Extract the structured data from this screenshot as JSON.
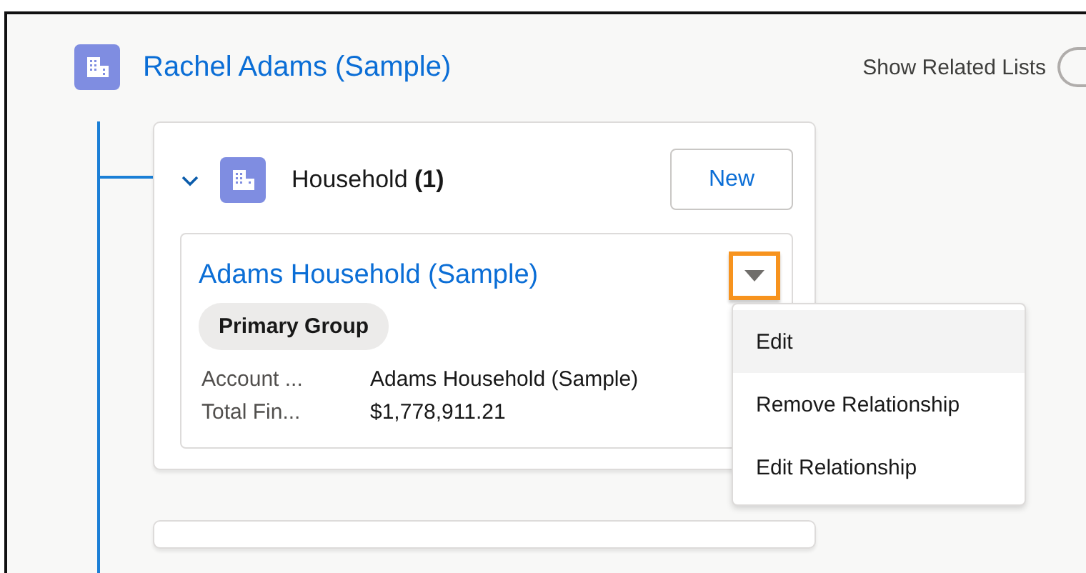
{
  "header": {
    "title": "Rachel Adams (Sample)",
    "show_related_lists": "Show Related Lists",
    "toggle_on": false
  },
  "related_list": {
    "expanded": true,
    "title": "Household",
    "count": "(1)",
    "new_button": "New",
    "record": {
      "name": "Adams Household (Sample)",
      "badge": "Primary Group",
      "menu_focused": true,
      "fields": [
        {
          "label": "Account ...",
          "value": "Adams Household (Sample)"
        },
        {
          "label": "Total Fin...",
          "value": "$1,778,911.21"
        }
      ]
    }
  },
  "menu": {
    "items": [
      {
        "label": "Edit",
        "selected": true
      },
      {
        "label": "Remove Relationship",
        "selected": false
      },
      {
        "label": "Edit Relationship",
        "selected": false
      }
    ]
  }
}
